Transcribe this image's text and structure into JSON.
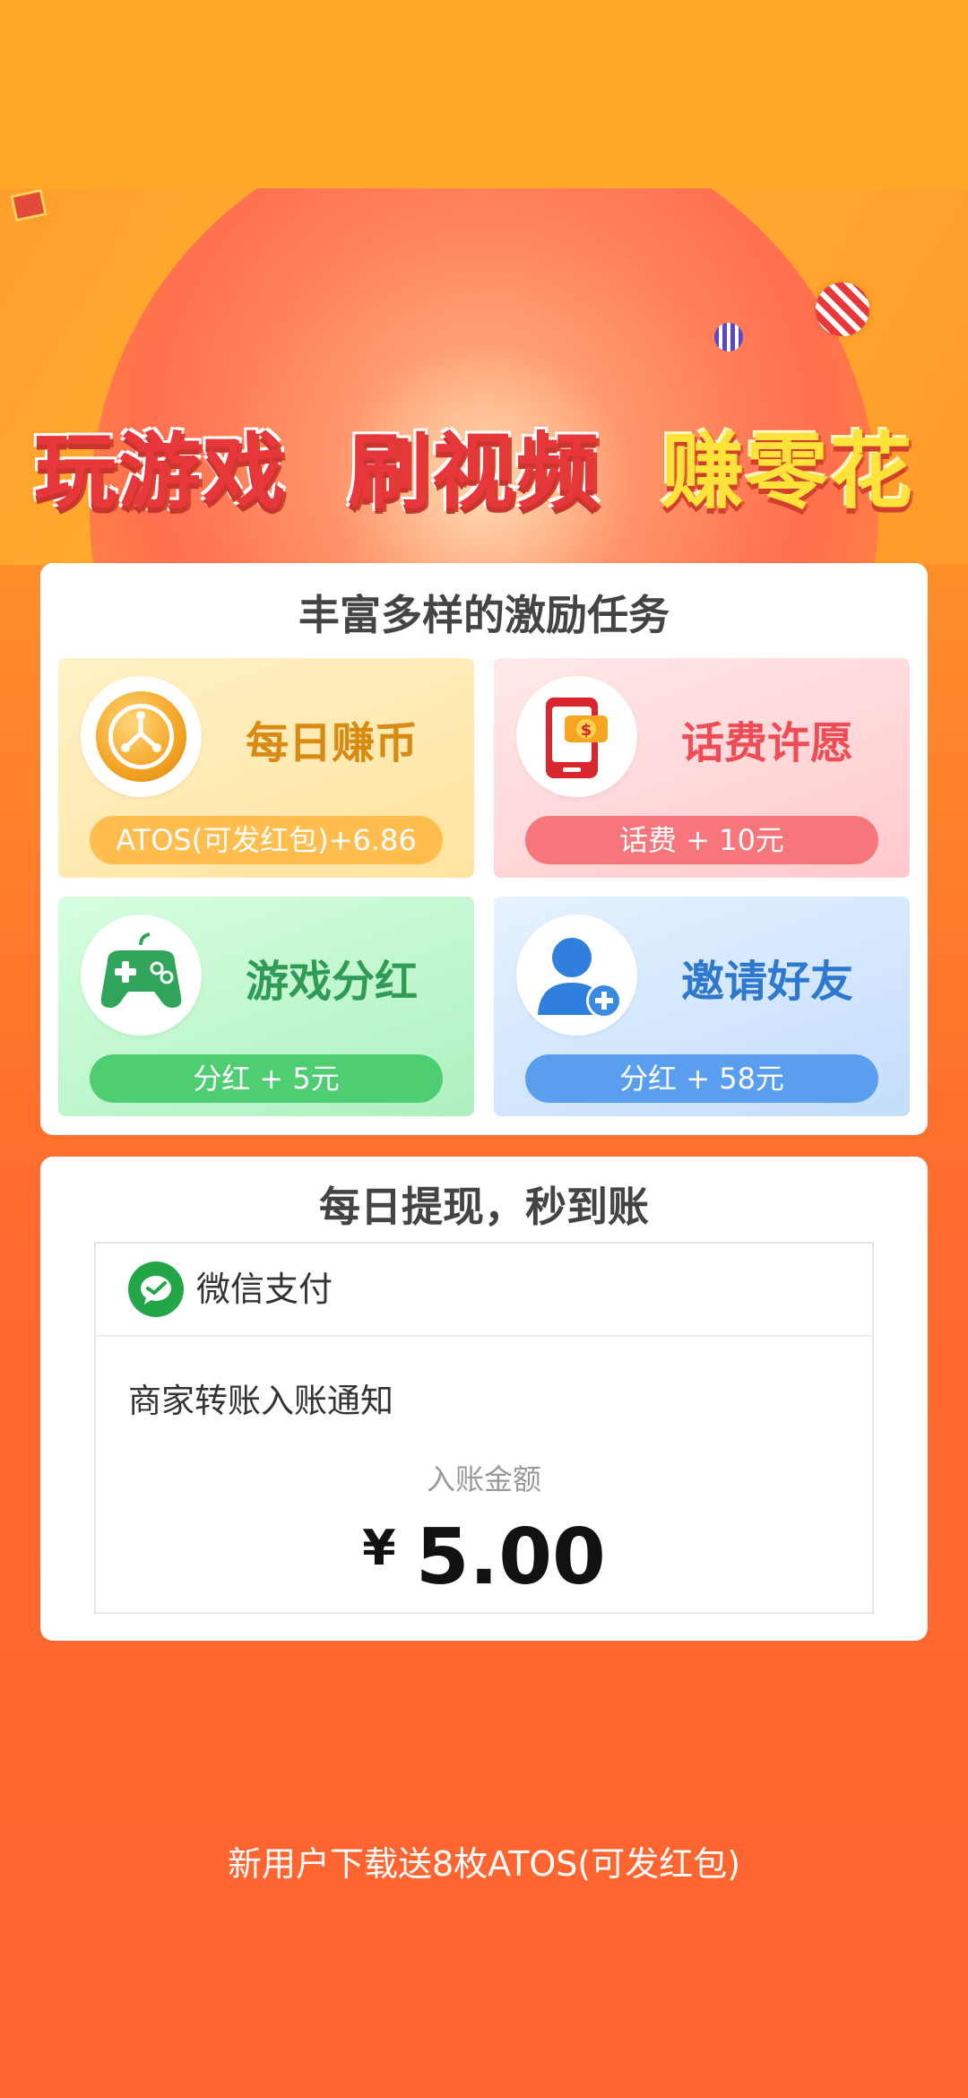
{
  "banner": {
    "slogans": [
      "玩游戏",
      "刷视频",
      "赚零花"
    ]
  },
  "tasks": {
    "title": "丰富多样的激励任务",
    "items": [
      {
        "label": "每日赚币",
        "reward": "ATOS(可发红包)+6.86",
        "icon": "coin-icon",
        "color": "#d98a13"
      },
      {
        "label": "话费许愿",
        "reward": "话费 + 10元",
        "icon": "phone-money-icon",
        "color": "#ef4c55"
      },
      {
        "label": "游戏分红",
        "reward": "分红 + 5元",
        "icon": "gamepad-icon",
        "color": "#2f9b57"
      },
      {
        "label": "邀请好友",
        "reward": "分红 + 58元",
        "icon": "add-user-icon",
        "color": "#2f78d0"
      }
    ]
  },
  "withdraw": {
    "title": "每日提现，秒到账",
    "pay_brand": "微信支付",
    "notice": "商家转账入账通知",
    "amount_label": "入账金额",
    "currency": "¥",
    "amount": "5.00"
  },
  "footer": {
    "text": "新用户下载送8枚ATOS(可发红包)"
  }
}
